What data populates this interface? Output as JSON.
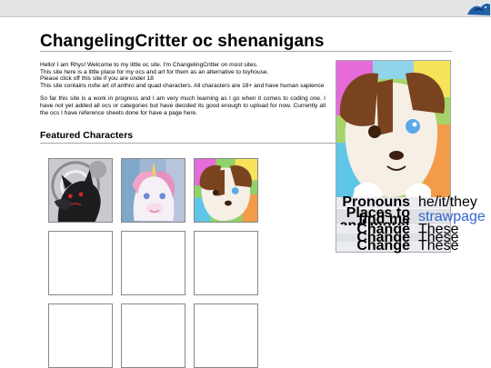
{
  "page": {
    "title": "ChangelingCritter oc shenanigans",
    "intro_paragraph_1": [
      "Hello! I am Rhys! Welcome to my little oc site. I'm ChangelingCritter on most sites.",
      "This site here is a little place for my ocs and art for them as an alternative to toyhouse.",
      "Please click off this site if you are under 18",
      "This site contains nsfw art of anthro and quad characters. All characters are 18+ and have human sapience"
    ],
    "intro_paragraph_2": "So far this site is a work in progress and I am very much learning as I go when it comes to coding one. I have not yet added all ocs or categories but have decided its good enough to upload for now. Currently all the ocs I have reference sheets done for have a page here.",
    "featured_heading": "Featured Characters"
  },
  "featured_tiles": [
    {
      "name": "black-wolf-character",
      "image": "dark canine character art"
    },
    {
      "name": "unicorn-character",
      "image": "pastel unicorn character art"
    },
    {
      "name": "border-collie-character",
      "image": "brown and white dog character art"
    },
    {
      "name": "empty-slot"
    },
    {
      "name": "empty-slot"
    },
    {
      "name": "empty-slot"
    },
    {
      "name": "empty-slot"
    },
    {
      "name": "empty-slot"
    },
    {
      "name": "empty-slot"
    }
  ],
  "infobox": {
    "rows": [
      {
        "label": "Pronouns",
        "value": "he/it/they",
        "link": false
      },
      {
        "label": "Places to find me and more!",
        "value": "strawpage",
        "link": true
      },
      {
        "label": "Change",
        "value": "These",
        "link": false
      },
      {
        "label": "Change",
        "value": "These",
        "link": false
      },
      {
        "label": "Change",
        "value": "These",
        "link": false
      }
    ]
  },
  "colors": {
    "topbar": "#e3e4e6",
    "rule": "#a2a9b1",
    "link": "#3366cc",
    "infobox_bg": "#f8f9fa"
  }
}
